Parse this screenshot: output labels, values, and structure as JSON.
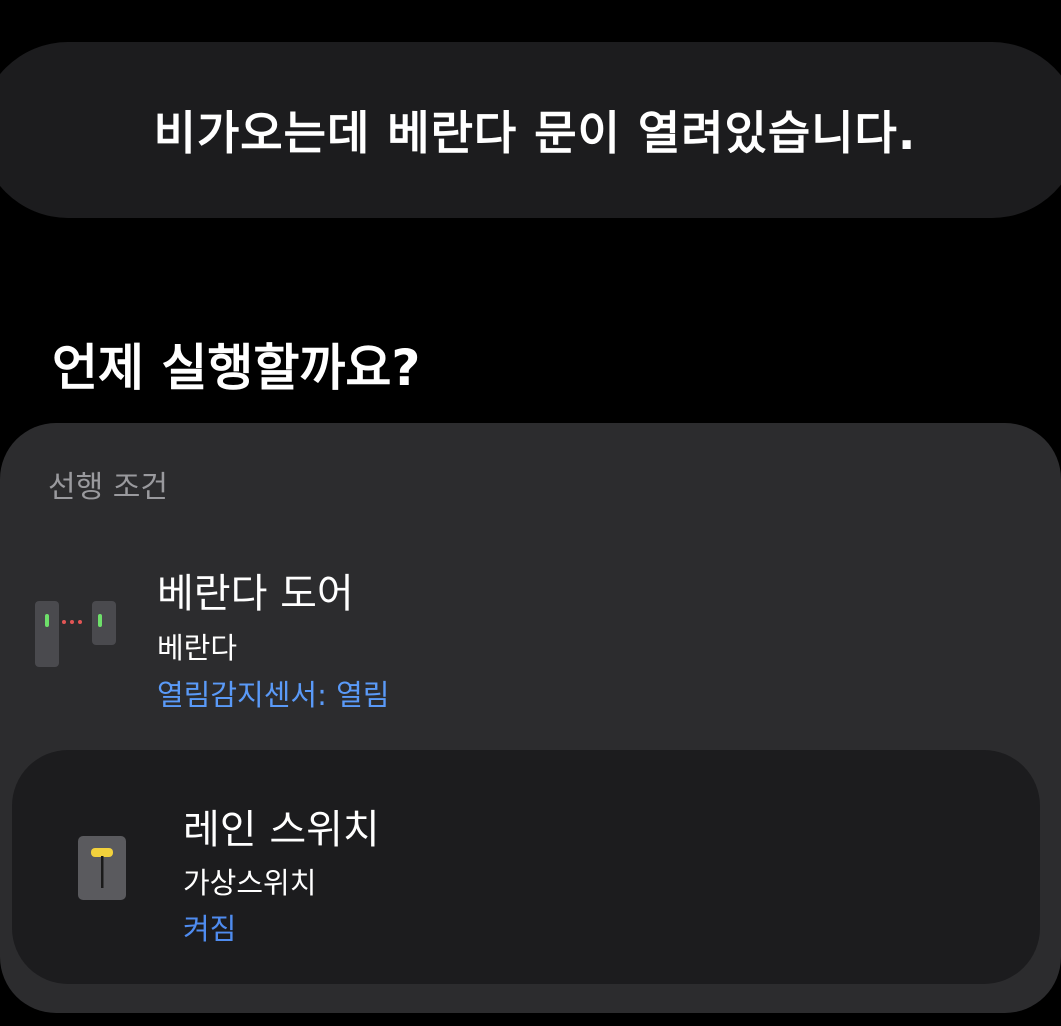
{
  "header": {
    "message": "비가오는데 베란다 문이 열려있습니다."
  },
  "section": {
    "heading": "언제 실행할까요?"
  },
  "precondition": {
    "label": "선행 조건",
    "items": [
      {
        "title": "베란다 도어",
        "location": "베란다",
        "status": "열림감지센서: 열림",
        "icon": "door-sensor-icon"
      },
      {
        "title": "레인 스위치",
        "location": "가상스위치",
        "status": "켜짐",
        "icon": "virtual-switch-icon"
      }
    ]
  },
  "colors": {
    "background": "#000000",
    "surface": "#1c1c1e",
    "card": "#2c2c2e",
    "accent_blue": "#5a9af8",
    "status_blue": "#4f8cf0",
    "muted_text": "#9a9a9e",
    "sensor_green": "#6ee06a",
    "sensor_red": "#e25555",
    "switch_yellow": "#f2d13c"
  }
}
